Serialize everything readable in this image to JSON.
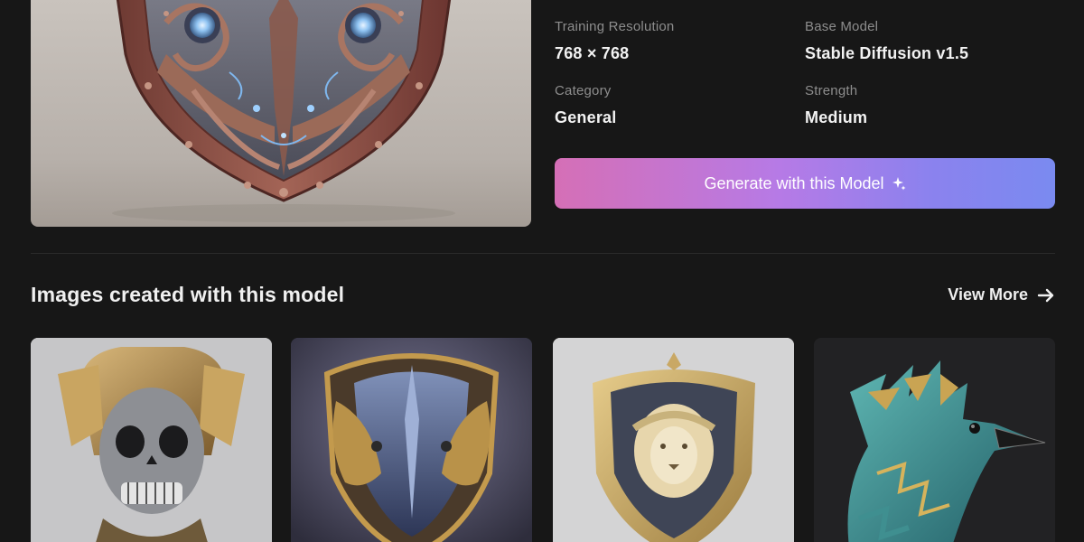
{
  "details": [
    {
      "label": "Training Resolution",
      "value": "768 × 768"
    },
    {
      "label": "Base Model",
      "value": "Stable Diffusion v1.5"
    },
    {
      "label": "Category",
      "value": "General"
    },
    {
      "label": "Strength",
      "value": "Medium"
    }
  ],
  "actions": {
    "generate_label": "Generate with this Model",
    "generate_icon": "sparkle-icon"
  },
  "gallery": {
    "title": "Images created with this model",
    "view_more_label": "View More",
    "view_more_icon": "arrow-right-icon",
    "items": [
      {
        "name": "skull-helmet-image",
        "background": "#c8c8c9"
      },
      {
        "name": "eagle-shield-image",
        "background": "#3b3a4a"
      },
      {
        "name": "lion-shield-image",
        "background": "#d2d2d3"
      },
      {
        "name": "teal-bird-image",
        "background": "#232323"
      }
    ]
  },
  "colors": {
    "page_background": "#171717",
    "label_color": "#8d8d8d",
    "button_gradient_start": "#d56fb6",
    "button_gradient_end": "#7a8af0"
  }
}
